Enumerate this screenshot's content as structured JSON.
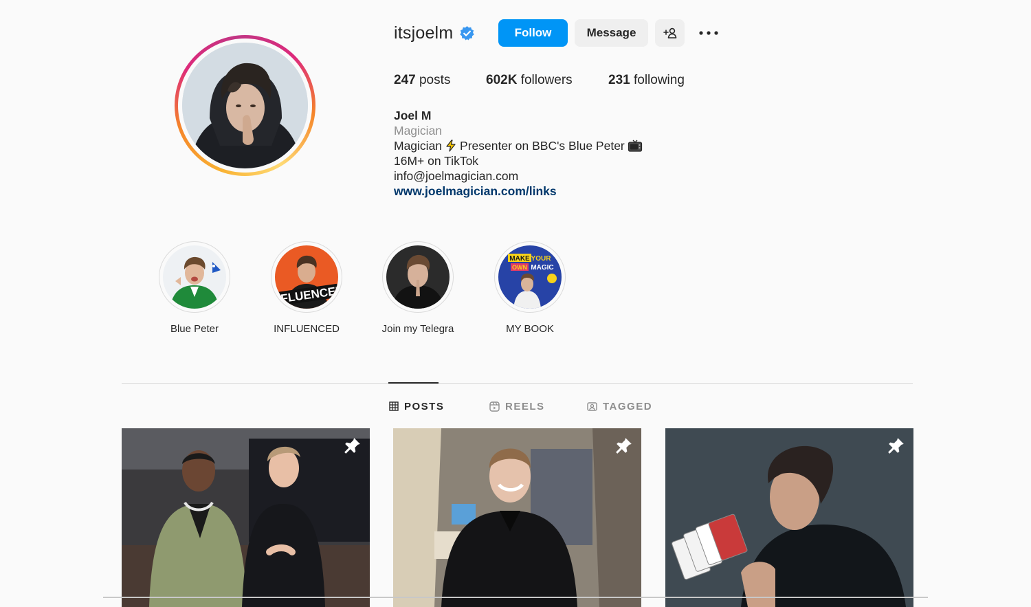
{
  "profile": {
    "username": "itsjoelm",
    "verified": true,
    "follow_label": "Follow",
    "message_label": "Message",
    "add_user_label": "+👤"
  },
  "stats": {
    "posts_count": "247",
    "posts_label": "posts",
    "followers_count": "602K",
    "followers_label": "followers",
    "following_count": "231",
    "following_label": "following"
  },
  "bio": {
    "name": "Joel M",
    "category": "Magician",
    "line1_a": "Magician",
    "line1_b": "Presenter on BBC's Blue Peter",
    "line2": "16M+ on TikTok",
    "email": "info@joelmagician.com",
    "link": "www.joelmagician.com/links"
  },
  "highlights": [
    {
      "label": "Blue Peter"
    },
    {
      "label": "INFLUENCED"
    },
    {
      "label": "Join my Telegra"
    },
    {
      "label": "MY BOOK"
    }
  ],
  "highlight_text": {
    "influenced": "INFLUENCED",
    "book_make": "MAKE",
    "book_your": "YOUR",
    "book_own": "OWN",
    "book_magic": "MAGIC"
  },
  "tabs": [
    {
      "label": "POSTS",
      "active": true
    },
    {
      "label": "REELS",
      "active": false
    },
    {
      "label": "TAGGED",
      "active": false
    }
  ],
  "colors": {
    "accent": "#0095f6",
    "link": "#00376b",
    "muted": "#8e8e8e",
    "background": "#fafafa"
  },
  "icons": {
    "verified": "verified-badge-icon",
    "more": "more-horizontal-icon",
    "pin": "pin-icon",
    "grid": "grid-icon",
    "reels": "reels-icon",
    "tagged": "tagged-icon"
  }
}
